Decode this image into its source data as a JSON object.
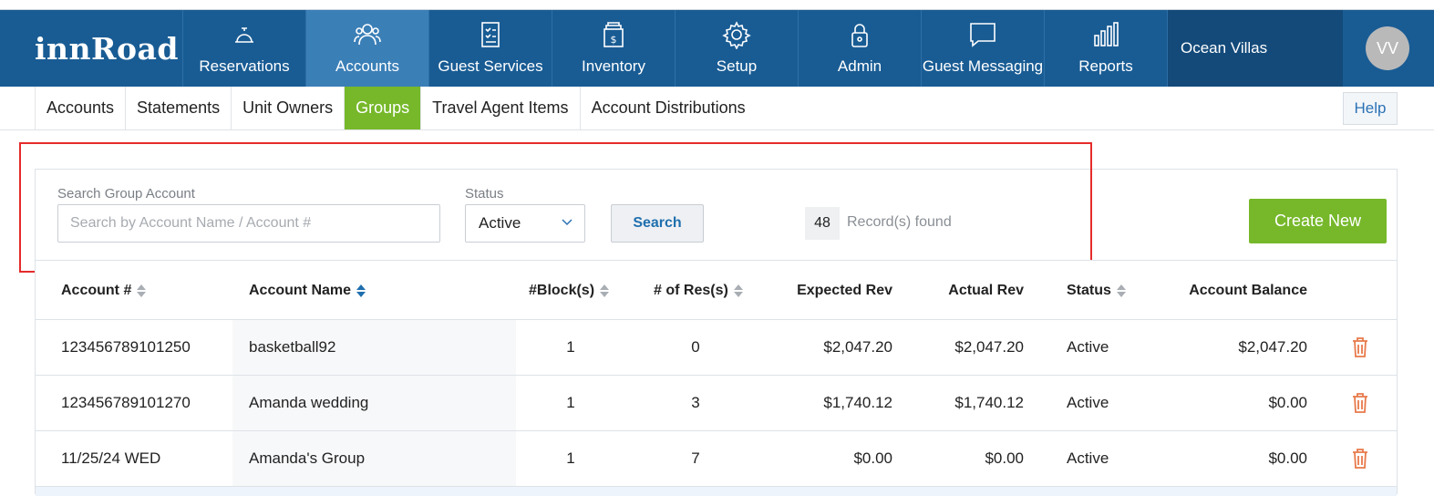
{
  "brand": {
    "logo_text": "innRoad"
  },
  "topnav": {
    "items": [
      {
        "label": "Reservations",
        "icon": "bell-icon"
      },
      {
        "label": "Accounts",
        "icon": "people-icon"
      },
      {
        "label": "Guest Services",
        "icon": "clipboard-icon"
      },
      {
        "label": "Inventory",
        "icon": "inventory-box-icon"
      },
      {
        "label": "Setup",
        "icon": "gear-icon"
      },
      {
        "label": "Admin",
        "icon": "lock-icon"
      },
      {
        "label": "Guest Messaging",
        "icon": "message-icon"
      },
      {
        "label": "Reports",
        "icon": "bar-chart-icon"
      }
    ],
    "active": "Accounts",
    "property_name": "Ocean Villas",
    "user_initials": "VV"
  },
  "subnav": {
    "items": [
      "Accounts",
      "Statements",
      "Unit Owners",
      "Groups",
      "Travel Agent Items",
      "Account Distributions"
    ],
    "active": "Groups",
    "help_label": "Help"
  },
  "search": {
    "account_label": "Search Group Account",
    "account_placeholder": "Search by Account Name / Account #",
    "account_value": "",
    "status_label": "Status",
    "status_value": "Active",
    "search_button": "Search",
    "record_count": "48",
    "record_label": "Record(s) found",
    "create_button": "Create New"
  },
  "table": {
    "columns": [
      "Account #",
      "Account Name",
      "#Block(s)",
      "# of Res(s)",
      "Expected Rev",
      "Actual Rev",
      "Status",
      "Account Balance"
    ],
    "rows": [
      {
        "account_no": "123456789101250",
        "name": "basketball92",
        "blocks": "1",
        "res": "0",
        "expected": "$2,047.20",
        "actual": "$2,047.20",
        "status": "Active",
        "balance": "$2,047.20"
      },
      {
        "account_no": "123456789101270",
        "name": "Amanda wedding",
        "blocks": "1",
        "res": "3",
        "expected": "$1,740.12",
        "actual": "$1,740.12",
        "status": "Active",
        "balance": "$0.00"
      },
      {
        "account_no": "11/25/24 WED",
        "name": "Amanda's Group",
        "blocks": "1",
        "res": "7",
        "expected": "$0.00",
        "actual": "$0.00",
        "status": "Active",
        "balance": "$0.00"
      }
    ]
  },
  "colors": {
    "nav_bg": "#195c94",
    "nav_active": "#3b7fb7",
    "accent_green": "#76b82a",
    "highlight_red": "#e52b2b",
    "trash_orange": "#e8794a"
  }
}
